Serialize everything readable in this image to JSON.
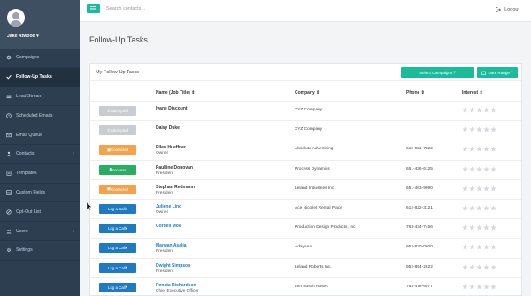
{
  "sidebar": {
    "user_name": "Jake Atwood",
    "items": [
      {
        "label": "Campaigns",
        "icon": "gear-icon"
      },
      {
        "label": "Follow-Up Tasks",
        "icon": "check-icon"
      },
      {
        "label": "Lead Stream",
        "icon": "stream-icon"
      },
      {
        "label": "Scheduled Emails",
        "icon": "clock-icon"
      },
      {
        "label": "Email Queue",
        "icon": "envelope-icon"
      },
      {
        "label": "Contacts",
        "icon": "contacts-icon"
      },
      {
        "label": "Templates",
        "icon": "template-icon"
      },
      {
        "label": "Custom Fields",
        "icon": "fields-icon"
      },
      {
        "label": "Opt-Out List",
        "icon": "optout-icon"
      },
      {
        "label": "Users",
        "icon": "users-icon"
      },
      {
        "label": "Settings",
        "icon": "settings-icon"
      }
    ]
  },
  "topbar": {
    "search_placeholder": "Search contacts...",
    "logout_label": "Logout"
  },
  "page": {
    "title": "Follow-Up Tasks"
  },
  "card": {
    "title": "My Follow-Up Tasks",
    "select_campaigns_label": "Select Campaigns",
    "date_range_label": "Date Range"
  },
  "table": {
    "headers": {
      "name": "Name (Job Title)",
      "company": "Company",
      "phone": "Phone",
      "interest": "Interest"
    },
    "rows": [
      {
        "action": "Attempted",
        "name": "Ivane Discount",
        "title": "",
        "company": "XYZ Company",
        "phone": "",
        "interest": 0
      },
      {
        "action": "Attempted",
        "name": "Daisy Duke",
        "title": "",
        "company": "XYZ Company",
        "phone": "",
        "interest": 0
      },
      {
        "action": "Contacted",
        "name": "Ellen Hueffner",
        "title": "Owner",
        "company": "Absolute Advertising",
        "phone": "612-921-7222",
        "interest": 0
      },
      {
        "action": "Success",
        "name": "Paulline Donovan",
        "title": "President",
        "company": "Process Dynamics",
        "phone": "651-436-6125",
        "interest": 0
      },
      {
        "action": "Contacted",
        "name": "Stephan Redmann",
        "title": "President",
        "company": "Leland Industries Inc",
        "phone": "651-463-9990",
        "interest": 0
      },
      {
        "action": "Log a Call",
        "name": "Juliene Lind",
        "title": "Owner",
        "company": "Ace Nicollet Rental Place",
        "phone": "612-822-3121",
        "interest": 0
      },
      {
        "action": "Log a Call",
        "name": "Cordell Moe",
        "title": "",
        "company": "Production Design Products, Inc",
        "phone": "763-434-7456",
        "interest": 0
      },
      {
        "action": "Log a Call",
        "name": "Marwan Asalia",
        "title": "President",
        "company": "Adayana",
        "phone": "952-830-0600",
        "interest": 0
      },
      {
        "action": "Log a Call",
        "name": "Dwight Simpson",
        "title": "President",
        "company": "Leland Roberts Inc.",
        "phone": "952-854-2622",
        "interest": 0
      },
      {
        "action": "Log a Call",
        "name": "Renata Richardson",
        "title": "Chief Executive Officer",
        "company": "Len Busch Roses",
        "phone": "763-478-6077",
        "interest": 0
      }
    ]
  },
  "colors": {
    "sidebar": "#2c3e50",
    "accent": "#1abc9c",
    "attempted": "#c9ccd0",
    "contacted": "#f5a34a",
    "success": "#27ae60",
    "log_call": "#1f7bc1"
  }
}
